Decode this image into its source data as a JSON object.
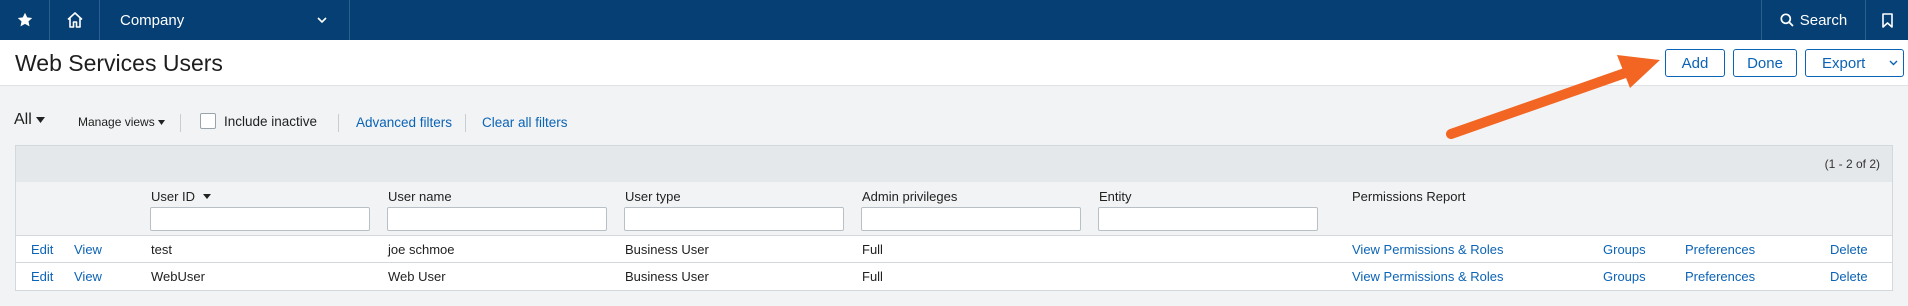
{
  "topbar": {
    "company_label": "Company",
    "search_label": "Search"
  },
  "page": {
    "title": "Web Services Users"
  },
  "actions": {
    "add": "Add",
    "done": "Done",
    "export": "Export"
  },
  "filters": {
    "view": "All",
    "manage_views": "Manage views",
    "include_inactive": "Include inactive",
    "advanced_filters": "Advanced filters",
    "clear_all_filters": "Clear all filters"
  },
  "grid": {
    "count": "(1 - 2 of 2)",
    "columns": {
      "user_id": "User ID",
      "user_name": "User name",
      "user_type": "User type",
      "admin_privileges": "Admin privileges",
      "entity": "Entity",
      "permissions_report": "Permissions Report"
    },
    "rows": [
      {
        "edit": "Edit",
        "view": "View",
        "user_id": "test",
        "user_name": "joe schmoe",
        "user_type": "Business User",
        "admin": "Full",
        "entity": "",
        "permissions": "View Permissions & Roles",
        "groups": "Groups",
        "preferences": "Preferences",
        "delete": "Delete"
      },
      {
        "edit": "Edit",
        "view": "View",
        "user_id": "WebUser",
        "user_name": "Web User",
        "user_type": "Business User",
        "admin": "Full",
        "entity": "",
        "permissions": "View Permissions & Roles",
        "groups": "Groups",
        "preferences": "Preferences",
        "delete": "Delete"
      }
    ]
  },
  "colors": {
    "topbar": "#053f73",
    "link": "#0b63b6",
    "annotation_arrow": "#f26522"
  },
  "icons": [
    "star-icon",
    "home-icon",
    "chevron-down-icon",
    "search-icon",
    "bookmark-icon",
    "caret-down-icon"
  ]
}
